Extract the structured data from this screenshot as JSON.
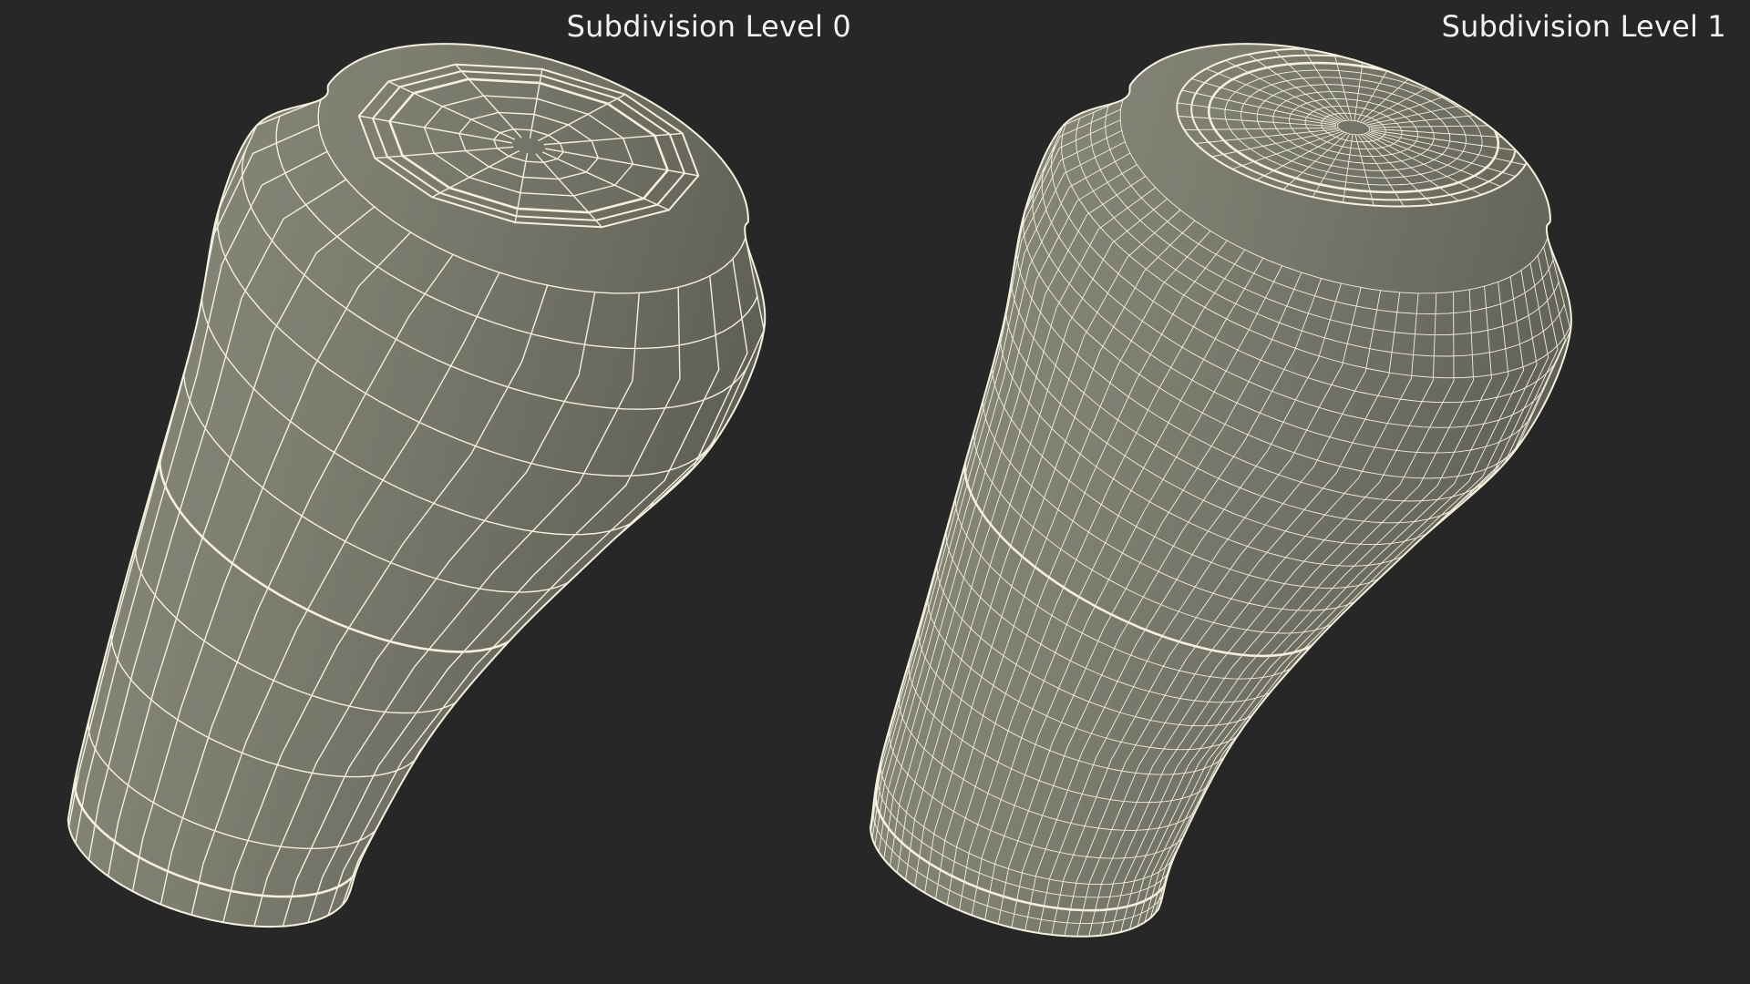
{
  "viewports": {
    "left": {
      "label": "Subdivision Level 0",
      "subdivision_level": 0
    },
    "right": {
      "label": "Subdivision Level 1",
      "subdivision_level": 1
    }
  },
  "colors": {
    "background": "#272727",
    "surface": "#7b7b6e",
    "wireframe": "#f3f1dc",
    "label": "#f2f2f2"
  }
}
